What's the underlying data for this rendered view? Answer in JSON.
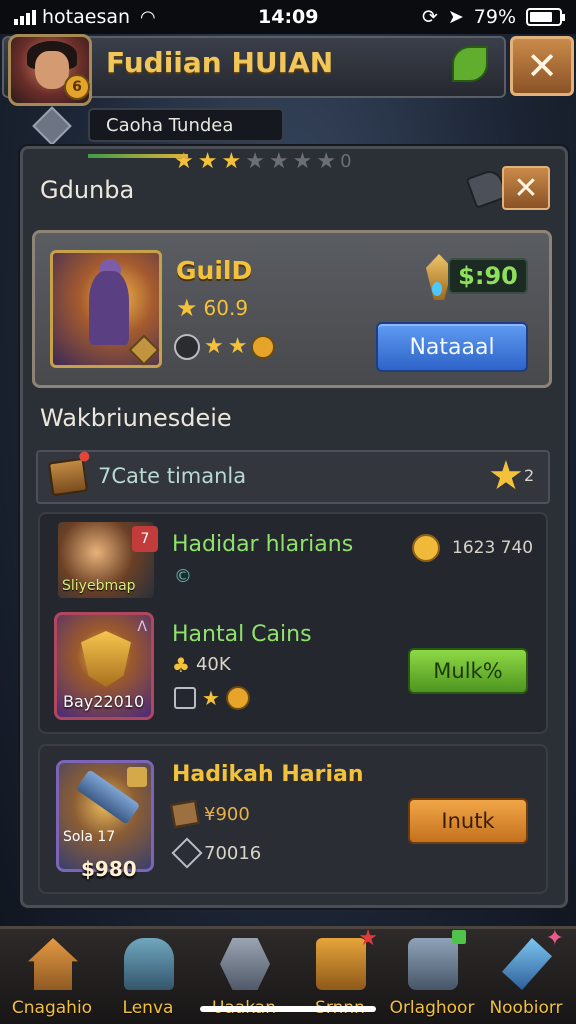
{
  "status_bar": {
    "carrier": "hotaesan",
    "time": "14:09",
    "battery": "79%",
    "battery_level": 0.79
  },
  "header": {
    "player_name": "Fudiian HUIAN",
    "avatar_badge": "6",
    "close_label": "✕",
    "sub_tab": "Caoha Tundea"
  },
  "panel": {
    "title": "Gdunba",
    "close_label": "✕",
    "stars_filled": 3,
    "stars_total": 7,
    "strip_text": "0"
  },
  "guild_card": {
    "name": "GuilD",
    "rating": "60.9",
    "price": "$:90",
    "action_label": "Nataaal"
  },
  "section": {
    "title": "Wakbriunesdeie",
    "filter_text": "7Cate timanla",
    "filter_count": "2"
  },
  "items": [
    {
      "title": "Hadidar hlarians",
      "thumb_label": "Sliyebmap",
      "badge": "7",
      "sub_text": "©",
      "count": "1623 740"
    },
    {
      "title": "Hantal Cains",
      "card_label": "Bay22010",
      "amount": "40K",
      "action_label": "Mulk%"
    },
    {
      "title": "Hadikah Harian",
      "card_label": "Sola 17",
      "card_price": "$980",
      "price": "¥900",
      "code": "70016",
      "action_label": "Inutk"
    }
  ],
  "bottom_nav": [
    {
      "label": "Cnagahio",
      "icon": "home-icon"
    },
    {
      "label": "Lenva",
      "icon": "tower-icon"
    },
    {
      "label": "Uaakan",
      "icon": "hexagon-icon"
    },
    {
      "label": "Srnnn",
      "icon": "scroll-icon"
    },
    {
      "label": "Orlaghoor",
      "icon": "treasure-box-icon"
    },
    {
      "label": "Noobiorr",
      "icon": "crystal-icon"
    }
  ],
  "colors": {
    "gold_text": "#f3c13a",
    "green_text": "#8fe36b",
    "blue_button": "#2e63c8",
    "green_button": "#4e9520",
    "orange_button": "#c4711f"
  }
}
